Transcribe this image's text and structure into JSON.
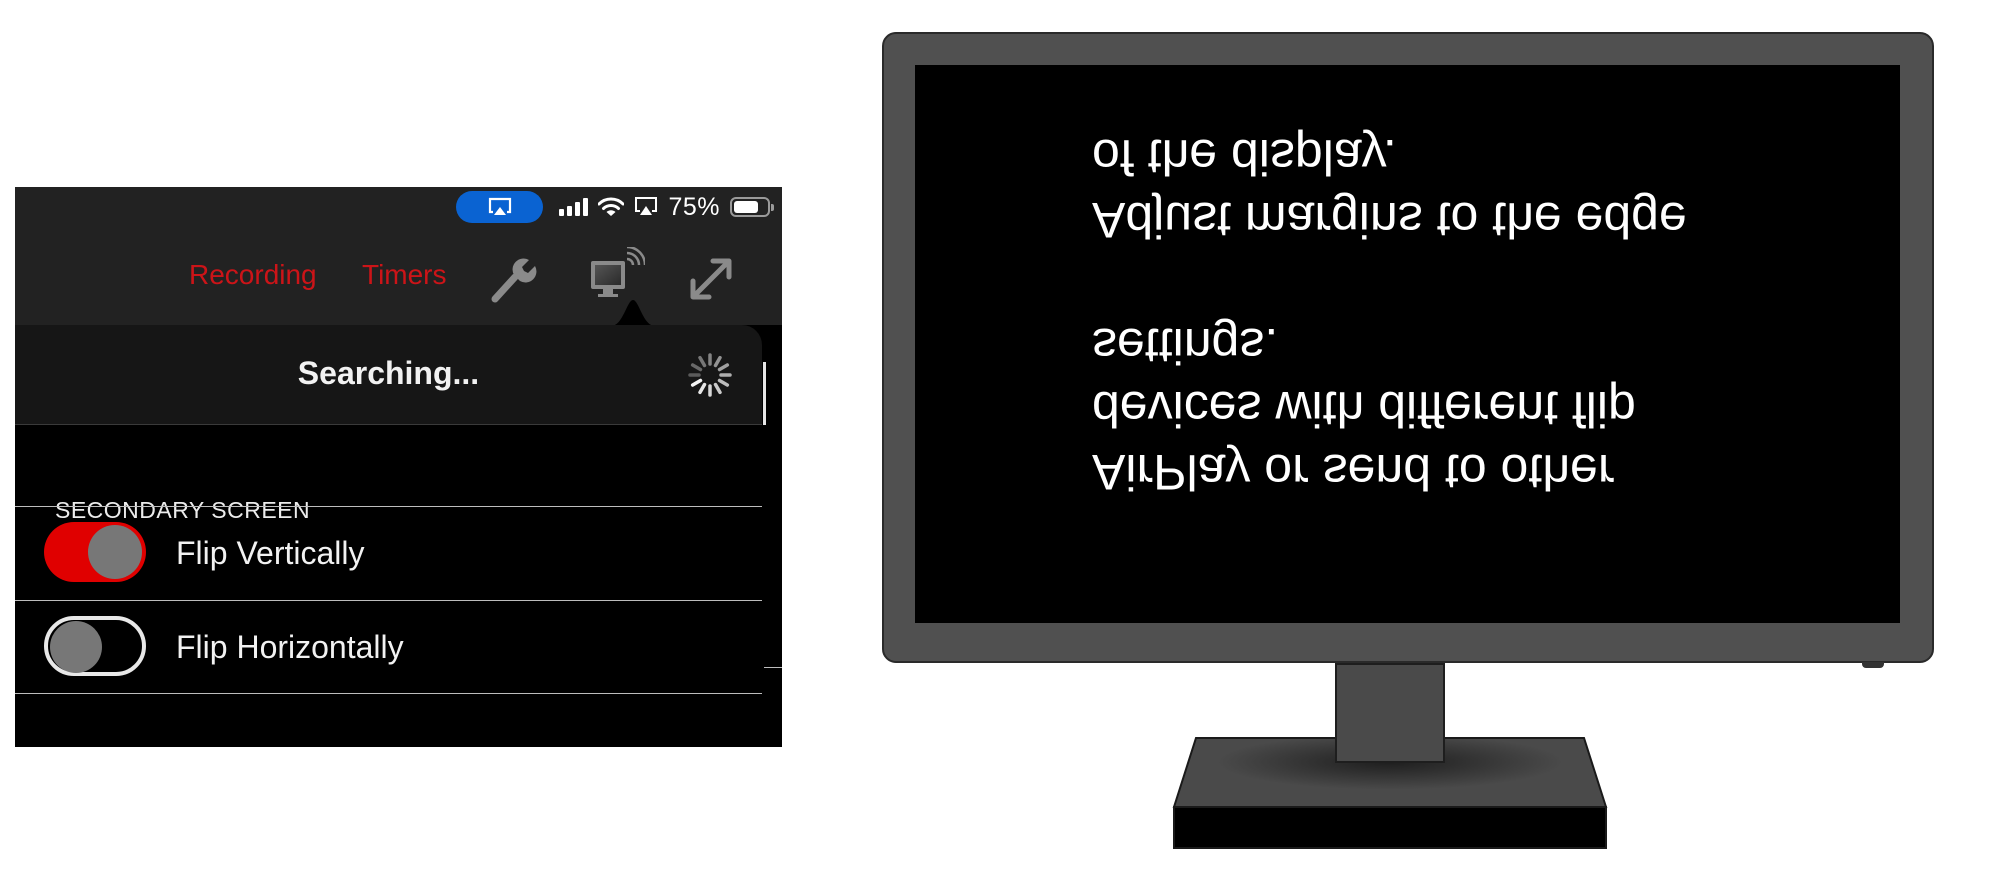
{
  "status_bar": {
    "airplay_pill_icon": "screen-mirroring-icon",
    "signal_icon": "cellular-signal-icon",
    "wifi_icon": "wifi-icon",
    "airplay_icon": "airplay-icon",
    "battery_percent": "75%",
    "battery_level": 0.75,
    "pill_color": "#0a63d2"
  },
  "toolbar": {
    "recording_label": "Recording",
    "timers_label": "Timers",
    "settings_icon": "wrench-icon",
    "external_display_icon": "external-display-icon",
    "fullscreen_icon": "expand-icon",
    "accent_color": "#cc1418"
  },
  "popover": {
    "title": "Searching...",
    "section_header": "SECONDARY SCREEN",
    "rows": [
      {
        "label": "Flip Vertically",
        "on": true
      },
      {
        "label": "Flip Horizontally",
        "on": false
      }
    ],
    "toggle_on_color": "#e00000"
  },
  "monitor": {
    "lines": [
      "AirPlay or send to other",
      "devices with different flip",
      "settings.",
      "",
      "Adjust margins to the edge",
      "of the display."
    ],
    "flip_vertical": true
  }
}
